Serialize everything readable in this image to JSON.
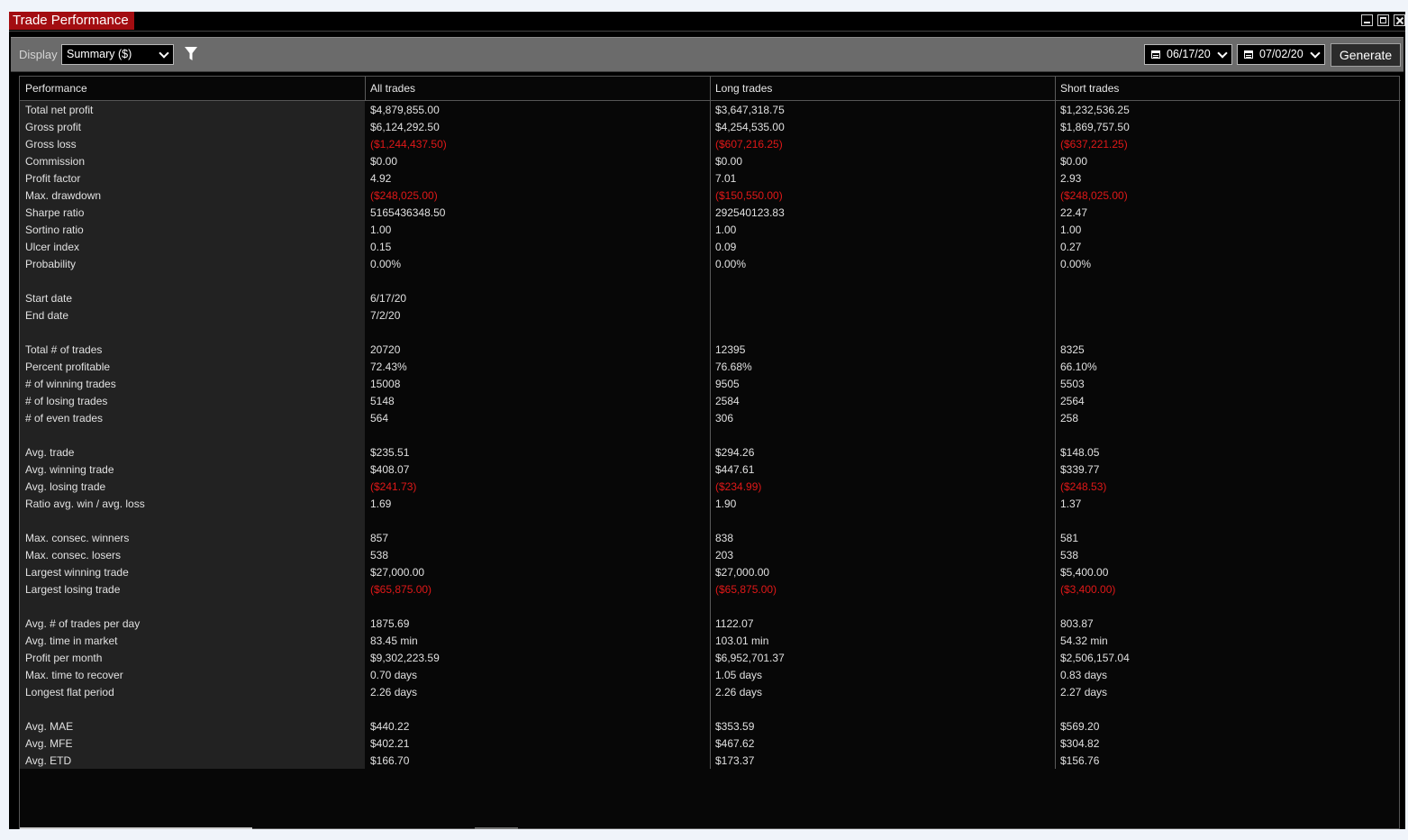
{
  "window": {
    "title": "Trade Performance"
  },
  "toolbar": {
    "display_label": "Display",
    "display_value": "Summary ($)",
    "date_from": "06/17/20",
    "date_to": "07/02/20",
    "generate_label": "Generate"
  },
  "colors": {
    "title_bg": "#a30d11",
    "negative": "#e01818"
  },
  "table": {
    "headers": [
      "Performance",
      "All trades",
      "Long trades",
      "Short trades"
    ],
    "rows": [
      {
        "label": "Total net profit",
        "all": "$4,879,855.00",
        "long": "$3,647,318.75",
        "short": "$1,232,536.25"
      },
      {
        "label": "Gross profit",
        "all": "$6,124,292.50",
        "long": "$4,254,535.00",
        "short": "$1,869,757.50"
      },
      {
        "label": "Gross loss",
        "all": "($1,244,437.50)",
        "long": "($607,216.25)",
        "short": "($637,221.25)",
        "negative": true
      },
      {
        "label": "Commission",
        "all": "$0.00",
        "long": "$0.00",
        "short": "$0.00"
      },
      {
        "label": "Profit factor",
        "all": "4.92",
        "long": "7.01",
        "short": "2.93"
      },
      {
        "label": "Max. drawdown",
        "all": "($248,025.00)",
        "long": "($150,550.00)",
        "short": "($248,025.00)",
        "negative": true
      },
      {
        "label": "Sharpe ratio",
        "all": "5165436348.50",
        "long": "292540123.83",
        "short": "22.47"
      },
      {
        "label": "Sortino ratio",
        "all": "1.00",
        "long": "1.00",
        "short": "1.00"
      },
      {
        "label": "Ulcer index",
        "all": "0.15",
        "long": "0.09",
        "short": "0.27"
      },
      {
        "label": "Probability",
        "all": "0.00%",
        "long": "0.00%",
        "short": "0.00%"
      },
      {
        "label": "",
        "all": "",
        "long": "",
        "short": ""
      },
      {
        "label": "Start date",
        "all": "6/17/20",
        "long": "",
        "short": ""
      },
      {
        "label": "End date",
        "all": "7/2/20",
        "long": "",
        "short": ""
      },
      {
        "label": "",
        "all": "",
        "long": "",
        "short": ""
      },
      {
        "label": "Total # of trades",
        "all": "20720",
        "long": "12395",
        "short": "8325"
      },
      {
        "label": "Percent profitable",
        "all": "72.43%",
        "long": "76.68%",
        "short": "66.10%"
      },
      {
        "label": "# of winning trades",
        "all": "15008",
        "long": "9505",
        "short": "5503"
      },
      {
        "label": "# of losing trades",
        "all": "5148",
        "long": "2584",
        "short": "2564"
      },
      {
        "label": "# of even trades",
        "all": "564",
        "long": "306",
        "short": "258"
      },
      {
        "label": "",
        "all": "",
        "long": "",
        "short": ""
      },
      {
        "label": "Avg. trade",
        "all": "$235.51",
        "long": "$294.26",
        "short": "$148.05"
      },
      {
        "label": "Avg. winning trade",
        "all": "$408.07",
        "long": "$447.61",
        "short": "$339.77"
      },
      {
        "label": "Avg. losing trade",
        "all": "($241.73)",
        "long": "($234.99)",
        "short": "($248.53)",
        "negative": true
      },
      {
        "label": "Ratio avg. win / avg. loss",
        "all": "1.69",
        "long": "1.90",
        "short": "1.37"
      },
      {
        "label": "",
        "all": "",
        "long": "",
        "short": ""
      },
      {
        "label": "Max. consec. winners",
        "all": "857",
        "long": "838",
        "short": "581"
      },
      {
        "label": "Max. consec. losers",
        "all": "538",
        "long": "203",
        "short": "538"
      },
      {
        "label": "Largest winning trade",
        "all": "$27,000.00",
        "long": "$27,000.00",
        "short": "$5,400.00"
      },
      {
        "label": "Largest losing trade",
        "all": "($65,875.00)",
        "long": "($65,875.00)",
        "short": "($3,400.00)",
        "negative": true
      },
      {
        "label": "",
        "all": "",
        "long": "",
        "short": ""
      },
      {
        "label": "Avg. # of trades per day",
        "all": "1875.69",
        "long": "1122.07",
        "short": "803.87"
      },
      {
        "label": "Avg. time in market",
        "all": "83.45 min",
        "long": "103.01 min",
        "short": "54.32 min"
      },
      {
        "label": "Profit per month",
        "all": "$9,302,223.59",
        "long": "$6,952,701.37",
        "short": "$2,506,157.04"
      },
      {
        "label": "Max. time to recover",
        "all": "0.70 days",
        "long": "1.05 days",
        "short": "0.83 days"
      },
      {
        "label": "Longest flat period",
        "all": "2.26 days",
        "long": "2.26 days",
        "short": "2.27 days"
      },
      {
        "label": "",
        "all": "",
        "long": "",
        "short": ""
      },
      {
        "label": "Avg. MAE",
        "all": "$440.22",
        "long": "$353.59",
        "short": "$569.20"
      },
      {
        "label": "Avg. MFE",
        "all": "$402.21",
        "long": "$467.62",
        "short": "$304.82"
      },
      {
        "label": "Avg. ETD",
        "all": "$166.70",
        "long": "$173.37",
        "short": "$156.76"
      }
    ]
  }
}
